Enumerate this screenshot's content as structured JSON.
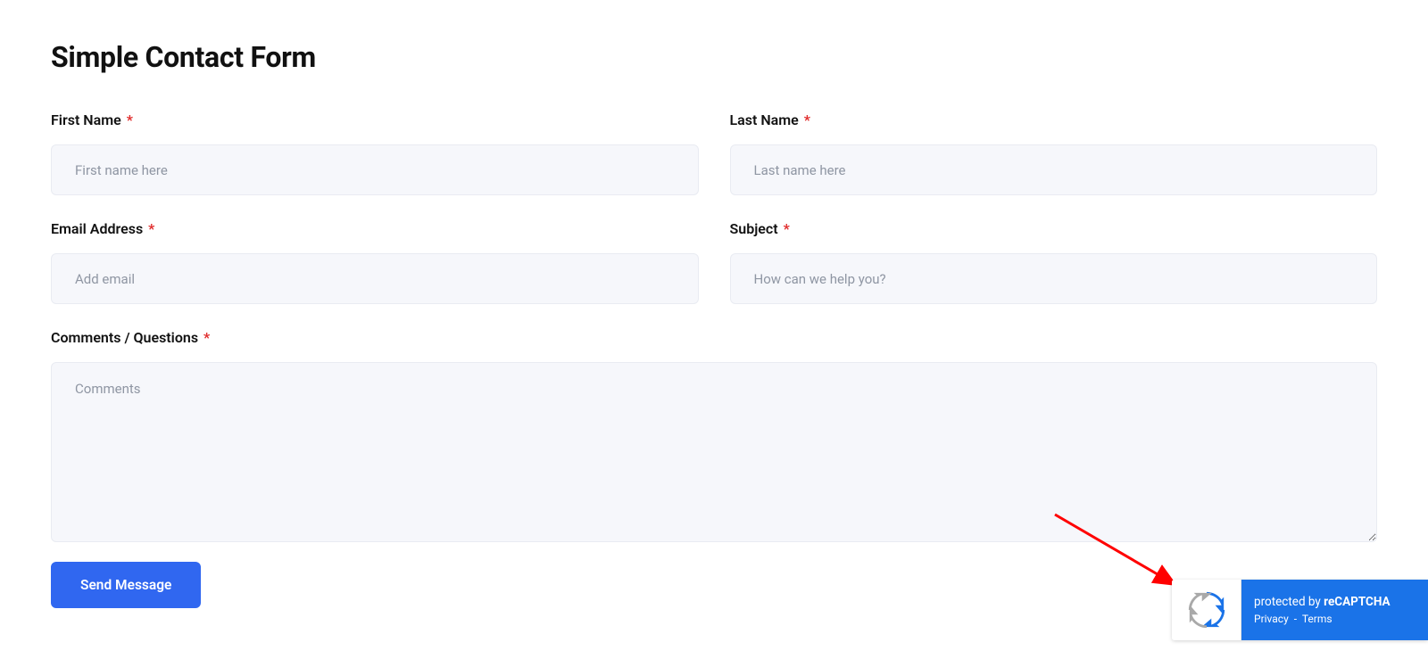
{
  "page": {
    "title": "Simple Contact Form"
  },
  "form": {
    "first_name": {
      "label": "First Name",
      "placeholder": "First name here",
      "value": ""
    },
    "last_name": {
      "label": "Last Name",
      "placeholder": "Last name here",
      "value": ""
    },
    "email": {
      "label": "Email Address",
      "placeholder": "Add email",
      "value": ""
    },
    "subject": {
      "label": "Subject",
      "placeholder": "How can we help you?",
      "value": ""
    },
    "comments": {
      "label": "Comments / Questions",
      "placeholder": "Comments",
      "value": ""
    },
    "required_marker": "*",
    "submit_label": "Send Message"
  },
  "recaptcha": {
    "protected_prefix": "protected by ",
    "brand": "reCAPTCHA",
    "privacy": "Privacy",
    "separator": "-",
    "terms": "Terms"
  }
}
